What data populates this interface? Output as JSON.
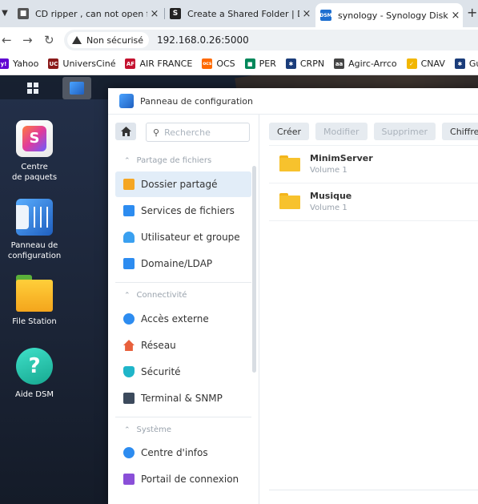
{
  "browser": {
    "tabs": [
      {
        "title": "CD ripper , can not open file sy",
        "favicon": "robot-icon"
      },
      {
        "title": "Create a Shared Folder | DSM -",
        "favicon": "s-icon"
      },
      {
        "title": "synology - Synology DiskStation",
        "favicon": "dsm-icon",
        "favicon_text": "DSM"
      }
    ],
    "tab_close": "×",
    "new_tab": "+",
    "security_label": "Non sécurisé",
    "url": "192.168.0.26:5000",
    "bookmarks": [
      {
        "label": "Yahoo",
        "color": "#6001d2"
      },
      {
        "label": "UniversCiné",
        "color": "#8b1a1a",
        "icon_text": "UC"
      },
      {
        "label": "AIR FRANCE",
        "color": "#c4122f",
        "icon_text": "AF"
      },
      {
        "label": "OCS",
        "color": "#ff6a00",
        "icon_text": "ocs"
      },
      {
        "label": "PER",
        "color": "#00875a"
      },
      {
        "label": "CRPN",
        "color": "#1a3c7a"
      },
      {
        "label": "Agirc-Arrco",
        "color": "#444444",
        "icon_text": "aa"
      },
      {
        "label": "CNAV",
        "color": "#f2b600"
      },
      {
        "label": "Guide étape par éta...",
        "color": "#1a3c7a"
      }
    ]
  },
  "desktop": {
    "icons": [
      {
        "label": "Centre\nde paquets"
      },
      {
        "label": "Panneau de\nconfiguration"
      },
      {
        "label": "File Station"
      },
      {
        "label": "Aide DSM"
      }
    ]
  },
  "window": {
    "title": "Panneau de configuration",
    "search_placeholder": "Recherche",
    "sections": [
      {
        "title": "Partage de fichiers",
        "items": [
          "Dossier partagé",
          "Services de fichiers",
          "Utilisateur et groupe",
          "Domaine/LDAP"
        ]
      },
      {
        "title": "Connectivité",
        "items": [
          "Accès externe",
          "Réseau",
          "Sécurité",
          "Terminal & SNMP"
        ]
      },
      {
        "title": "Système",
        "items": [
          "Centre d'infos",
          "Portail de connexion"
        ]
      }
    ],
    "selected_item": "Dossier partagé",
    "toolbar": [
      "Créer",
      "Modifier",
      "Supprimer",
      "Chiffreme"
    ],
    "folders": [
      {
        "name": "MinimServer",
        "volume": "Volume 1"
      },
      {
        "name": "Musique",
        "volume": "Volume 1"
      }
    ]
  },
  "colors": {
    "accent": "#1f7fd9",
    "folder": "#f7c22d",
    "selected_bg": "#e2edf8"
  }
}
